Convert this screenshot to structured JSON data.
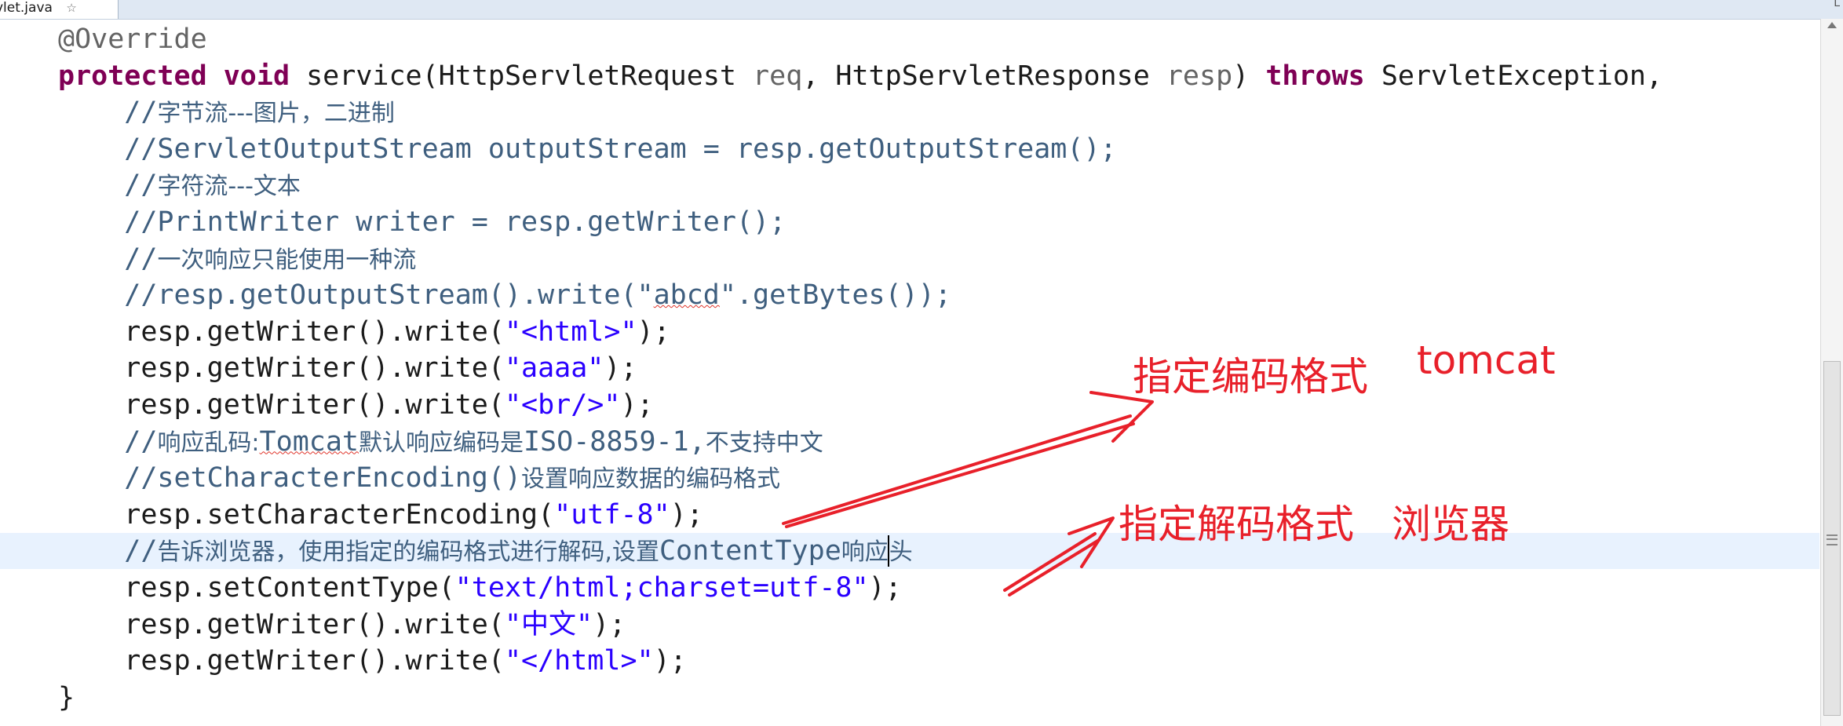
{
  "tab": {
    "title": "vlet.java",
    "close_glyph": "☆"
  },
  "window_corner": "L",
  "code_lines": [
    [
      {
        "t": "@Override",
        "c": "an"
      }
    ],
    [
      {
        "t": "protected",
        "c": "kw"
      },
      {
        "t": " "
      },
      {
        "t": "void",
        "c": "kw"
      },
      {
        "t": " service(HttpServletRequest "
      },
      {
        "t": "req",
        "c": "an"
      },
      {
        "t": ", HttpServletResponse "
      },
      {
        "t": "resp",
        "c": "an"
      },
      {
        "t": ") "
      },
      {
        "t": "throws",
        "c": "kw"
      },
      {
        "t": " ServletException,"
      }
    ],
    [
      {
        "t": "    //",
        "c": "cm"
      },
      {
        "t": "字节流---图片，二进制",
        "c": "cm cn"
      }
    ],
    [
      {
        "t": "    //ServletOutputStream outputStream = resp.getOutputStream();",
        "c": "cm"
      }
    ],
    [
      {
        "t": "    //",
        "c": "cm"
      },
      {
        "t": "字符流---文本",
        "c": "cm cn"
      }
    ],
    [
      {
        "t": "    //PrintWriter writer = resp.getWriter();",
        "c": "cm"
      }
    ],
    [
      {
        "t": "    //",
        "c": "cm"
      },
      {
        "t": "一次响应只能使用一种流",
        "c": "cm cn"
      }
    ],
    [
      {
        "t": "    //resp.getOutputStream().write(\"",
        "c": "cm"
      },
      {
        "t": "abcd",
        "c": "cm squig"
      },
      {
        "t": "\".getBytes());",
        "c": "cm"
      }
    ],
    [
      {
        "t": "    resp.getWriter().write("
      },
      {
        "t": "\"<html>\"",
        "c": "st"
      },
      {
        "t": ");"
      }
    ],
    [
      {
        "t": "    resp.getWriter().write("
      },
      {
        "t": "\"aaaa\"",
        "c": "st"
      },
      {
        "t": ");"
      }
    ],
    [
      {
        "t": "    resp.getWriter().write("
      },
      {
        "t": "\"<br/>\"",
        "c": "st"
      },
      {
        "t": ");"
      }
    ],
    [
      {
        "t": "    //",
        "c": "cm"
      },
      {
        "t": "响应乱码:",
        "c": "cm cn"
      },
      {
        "t": "Tomcat",
        "c": "cm squig"
      },
      {
        "t": "默认响应编码是",
        "c": "cm cn"
      },
      {
        "t": "ISO-8859-1,",
        "c": "cm"
      },
      {
        "t": "不支持中文",
        "c": "cm cn"
      }
    ],
    [
      {
        "t": "    //setCharacterEncoding()",
        "c": "cm"
      },
      {
        "t": "设置响应数据的编码格式",
        "c": "cm cn"
      }
    ],
    [
      {
        "t": "    resp.setCharacterEncoding("
      },
      {
        "t": "\"utf-8\"",
        "c": "st"
      },
      {
        "t": ");"
      }
    ],
    [
      {
        "t": "    //",
        "c": "cm"
      },
      {
        "t": "告诉浏览器，使用指定的编码格式进行解码,设置",
        "c": "cm cn"
      },
      {
        "t": "ContentType",
        "c": "cm"
      },
      {
        "t": "响应",
        "c": "cm cn"
      },
      {
        "t": "",
        "c": "caret"
      },
      {
        "t": "头",
        "c": "cm cn"
      }
    ],
    [
      {
        "t": "    resp.setContentType("
      },
      {
        "t": "\"text/html;charset=utf-8\"",
        "c": "st"
      },
      {
        "t": ");"
      }
    ],
    [
      {
        "t": "    resp.getWriter().write("
      },
      {
        "t": "\"中文\"",
        "c": "st"
      },
      {
        "t": ");"
      }
    ],
    [
      {
        "t": "    resp.getWriter().write("
      },
      {
        "t": "\"</html>\"",
        "c": "st"
      },
      {
        "t": ");"
      }
    ],
    [
      {
        "t": "}"
      }
    ]
  ],
  "current_line": 14,
  "annotations": [
    {
      "text": "指定编码格式"
    },
    {
      "text": "tomcat"
    },
    {
      "text": "指定解码格式"
    },
    {
      "text": "浏览器"
    }
  ],
  "colors": {
    "annotation": "#e8202a",
    "keyword": "#7f0055",
    "comment": "#3f5f7f",
    "string": "#2a00ff",
    "current_line": "#e8f2fe"
  }
}
